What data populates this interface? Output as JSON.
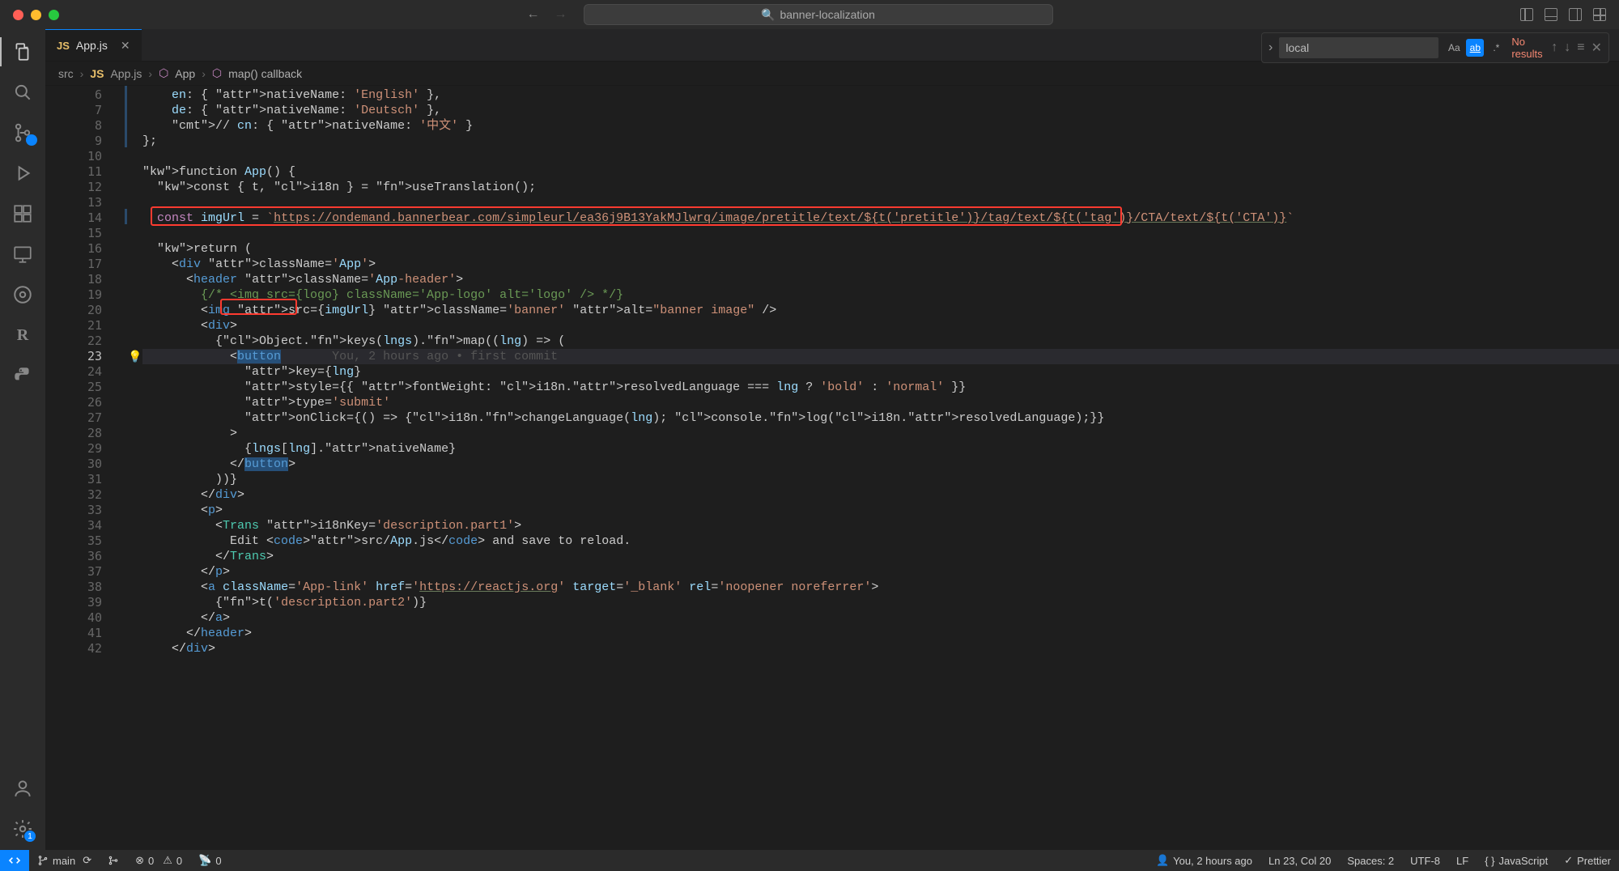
{
  "window": {
    "title": "banner-localization"
  },
  "tabs": [
    {
      "label": "App.js",
      "icon": "JS"
    }
  ],
  "breadcrumbs": {
    "folder": "src",
    "file": "App.js",
    "fileIcon": "JS",
    "sym1": "App",
    "sym2": "map() callback"
  },
  "find": {
    "value": "local",
    "result": "No results",
    "opts": {
      "case": "Aa",
      "word": "ab",
      "regex": ".*"
    }
  },
  "gutter": {
    "start": 6,
    "end": 42,
    "activeLine": 23
  },
  "blame": {
    "text": "You, 2 hours ago • first commit"
  },
  "code": {
    "l6": "    en: { nativeName: 'English' },",
    "l7": "    de: { nativeName: 'Deutsch' },",
    "l8": "    // cn: { nativeName: '中文' }",
    "l9": "};",
    "l10": "",
    "l11": "function App() {",
    "l12": "  const { t, i18n } = useTranslation();",
    "l13": "",
    "l14_pre": "  const imgUrl = `",
    "l14_url": "https://ondemand.bannerbear.com/simpleurl/ea36j9B13YakMJlwrq/image/pretitle/text/${t('pretitle')}/tag/text/${t('tag')}/CTA/text/${t('CTA')}",
    "l14_post": "`",
    "l15": "",
    "l16": "  return (",
    "l17": "    <div className='App'>",
    "l18": "      <header className='App-header'>",
    "l19": "        {/* <img src={logo} className='App-logo' alt='logo' /> */}",
    "l20": "        <img src={imgUrl} className='banner' alt=\"banner image\" />",
    "l21": "        <div>",
    "l22": "          {Object.keys(lngs).map((lng) => (",
    "l23": "            <button",
    "l24": "              key={lng}",
    "l25": "              style={{ fontWeight: i18n.resolvedLanguage === lng ? 'bold' : 'normal' }}",
    "l26": "              type='submit'",
    "l27": "              onClick={() => {i18n.changeLanguage(lng); console.log(i18n.resolvedLanguage);}}",
    "l28": "            >",
    "l29": "              {lngs[lng].nativeName}",
    "l30": "            </button>",
    "l31": "          ))}",
    "l32": "        </div>",
    "l33": "        <p>",
    "l34": "          <Trans i18nKey='description.part1'>",
    "l35": "            Edit <code>src/App.js</code> and save to reload.",
    "l36": "          </Trans>",
    "l37": "        </p>",
    "l38": "        <a className='App-link' href='https://reactjs.org' target='_blank' rel='noopener noreferrer'>",
    "l39": "          {t('description.part2')}",
    "l40": "        </a>",
    "l41": "      </header>",
    "l42": "    </div>"
  },
  "statusbar": {
    "branch": "main",
    "errors": "0",
    "warnings": "0",
    "ports": "0",
    "blame": "You, 2 hours ago",
    "cursor": "Ln 23, Col 20",
    "spaces": "Spaces: 2",
    "encoding": "UTF-8",
    "eol": "LF",
    "lang": "JavaScript",
    "prettier": "Prettier"
  }
}
